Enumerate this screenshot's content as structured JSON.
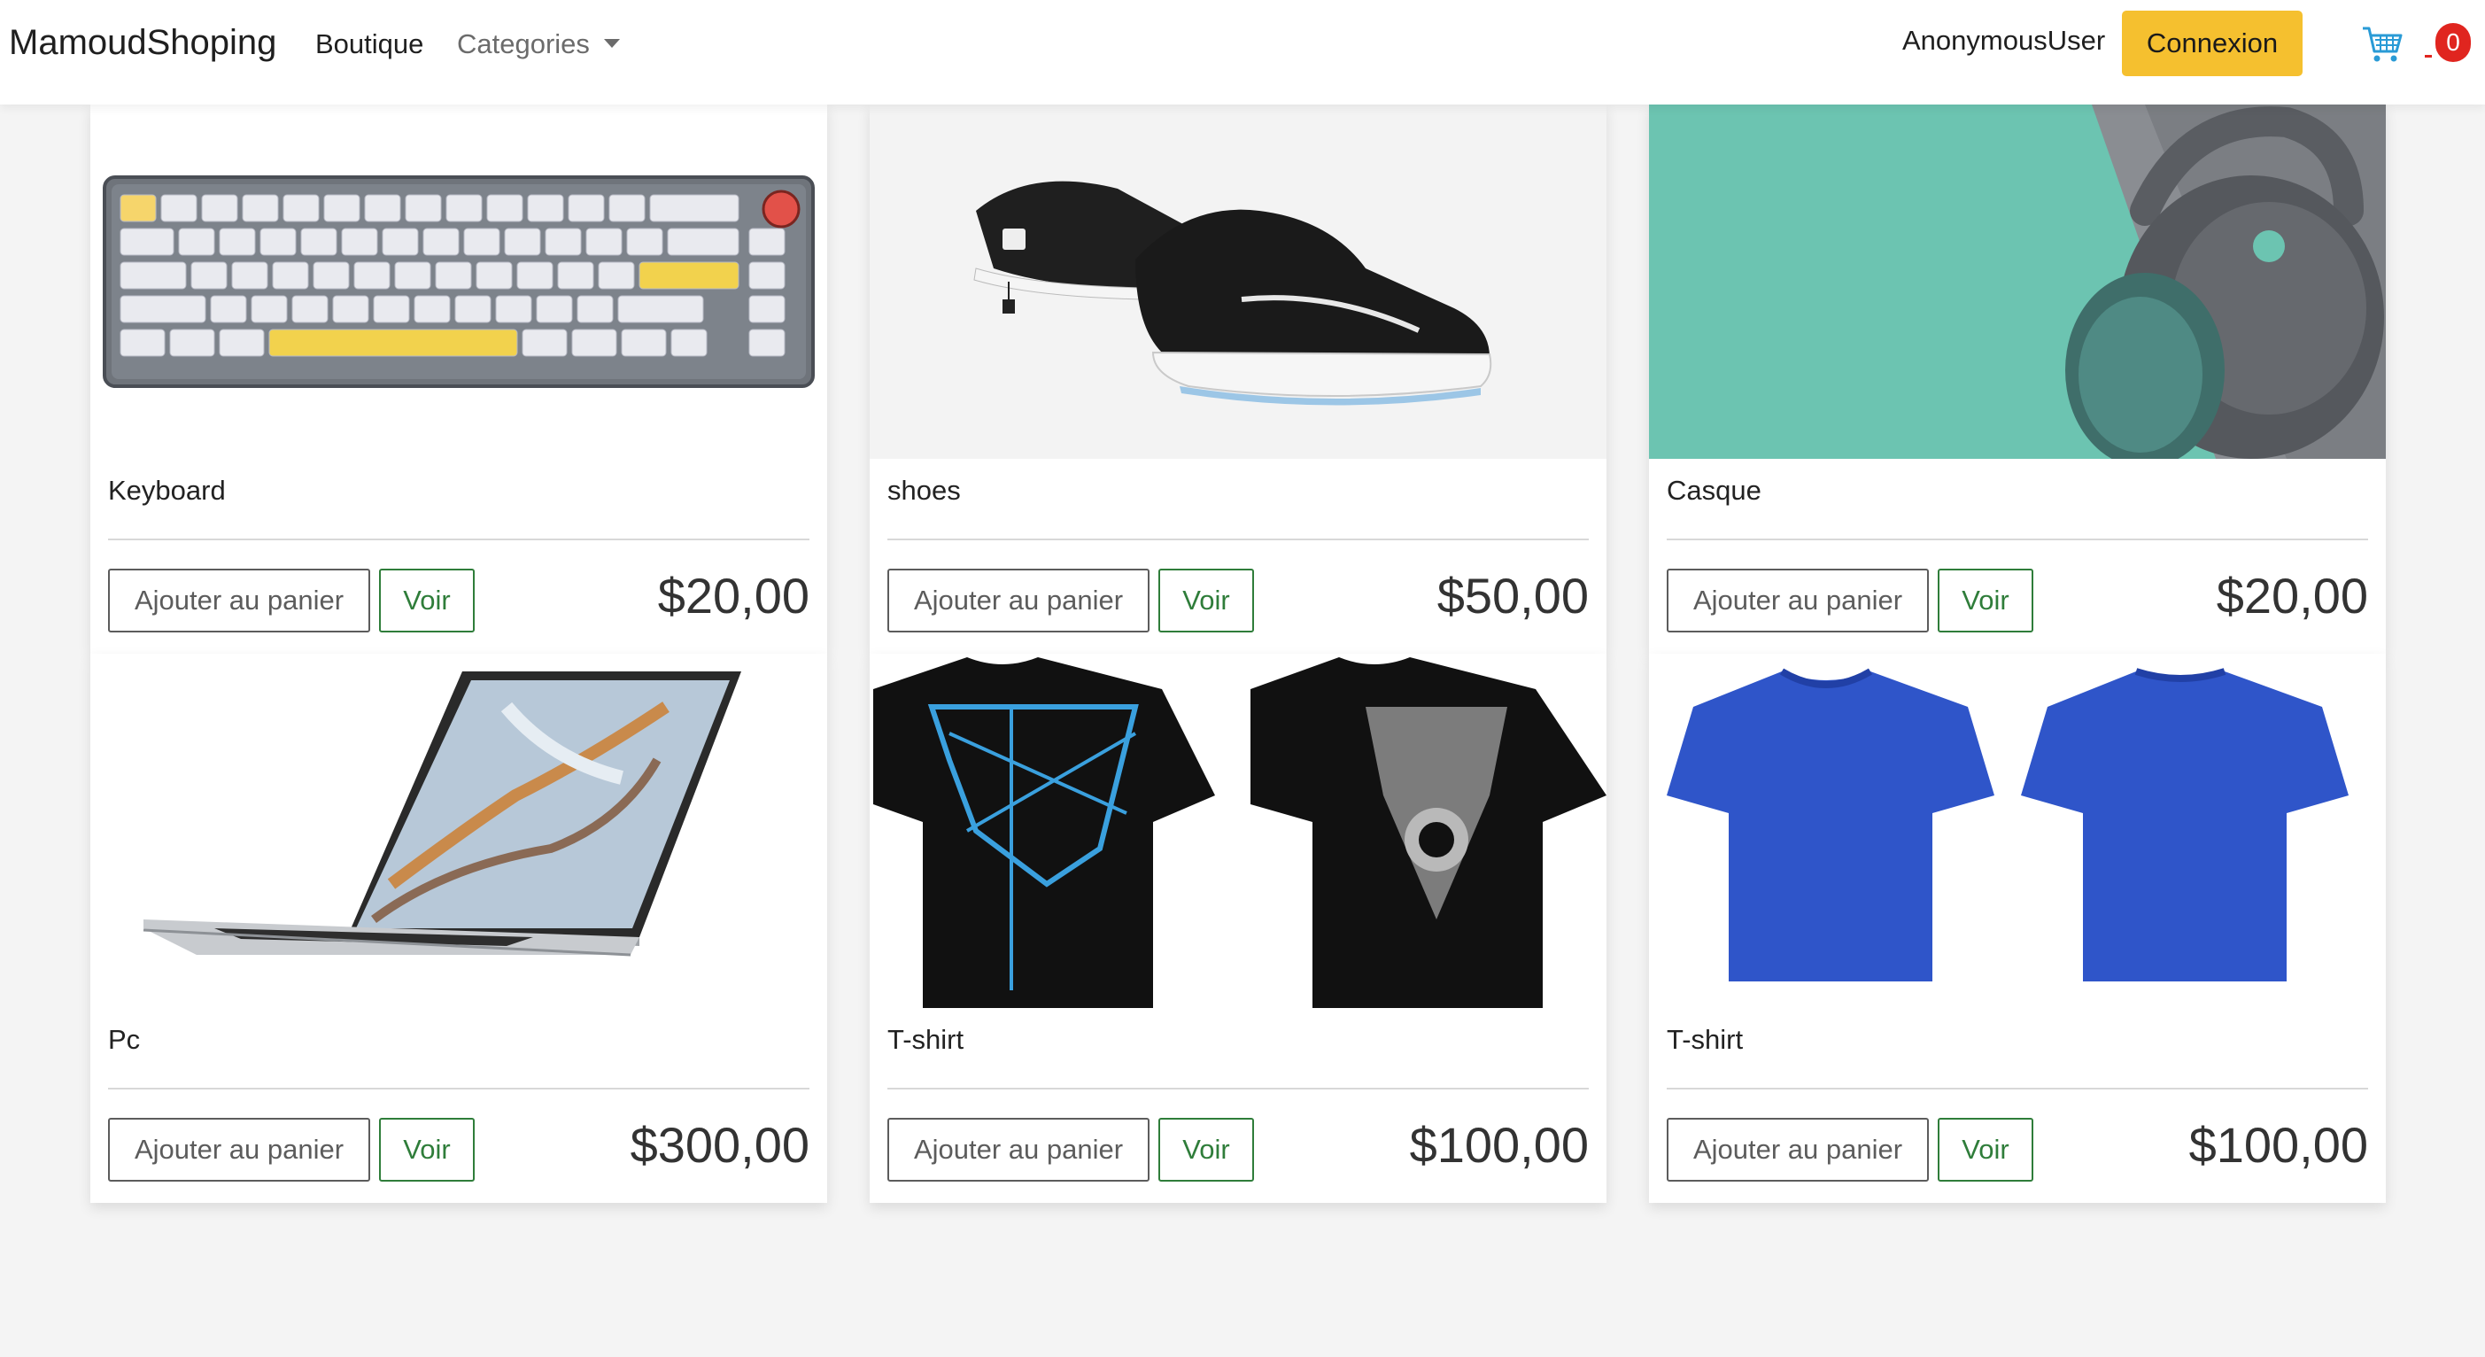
{
  "navbar": {
    "brand": "MamoudShoping",
    "links": [
      {
        "label": "Boutique"
      },
      {
        "label": "Categories"
      }
    ],
    "user": "AnonymousUser",
    "login_label": "Connexion",
    "cart_count": "0",
    "cart_icon": "shopping-cart-icon"
  },
  "products": [
    {
      "title": "Keyboard",
      "price": "$20,00",
      "add_label": "Ajouter au panier",
      "view_label": "Voir",
      "image": "keyboard-image"
    },
    {
      "title": "shoes",
      "price": "$50,00",
      "add_label": "Ajouter au panier",
      "view_label": "Voir",
      "image": "sneaker-image"
    },
    {
      "title": "Casque",
      "price": "$20,00",
      "add_label": "Ajouter au panier",
      "view_label": "Voir",
      "image": "headphones-image"
    },
    {
      "title": "Pc",
      "price": "$300,00",
      "add_label": "Ajouter au panier",
      "view_label": "Voir",
      "image": "laptop-image"
    },
    {
      "title": "T-shirt",
      "price": "$100,00",
      "add_label": "Ajouter au panier",
      "view_label": "Voir",
      "image": "black-tshirt-image"
    },
    {
      "title": "T-shirt",
      "price": "$100,00",
      "add_label": "Ajouter au panier",
      "view_label": "Voir",
      "image": "blue-tshirt-image"
    }
  ],
  "colors": {
    "login_button": "#f5c02f",
    "voir_button": "#2f7d3a",
    "cart_badge": "#e0251f",
    "cart_icon": "#2a9bd6",
    "headphones_bg": "#6cc4b1"
  }
}
